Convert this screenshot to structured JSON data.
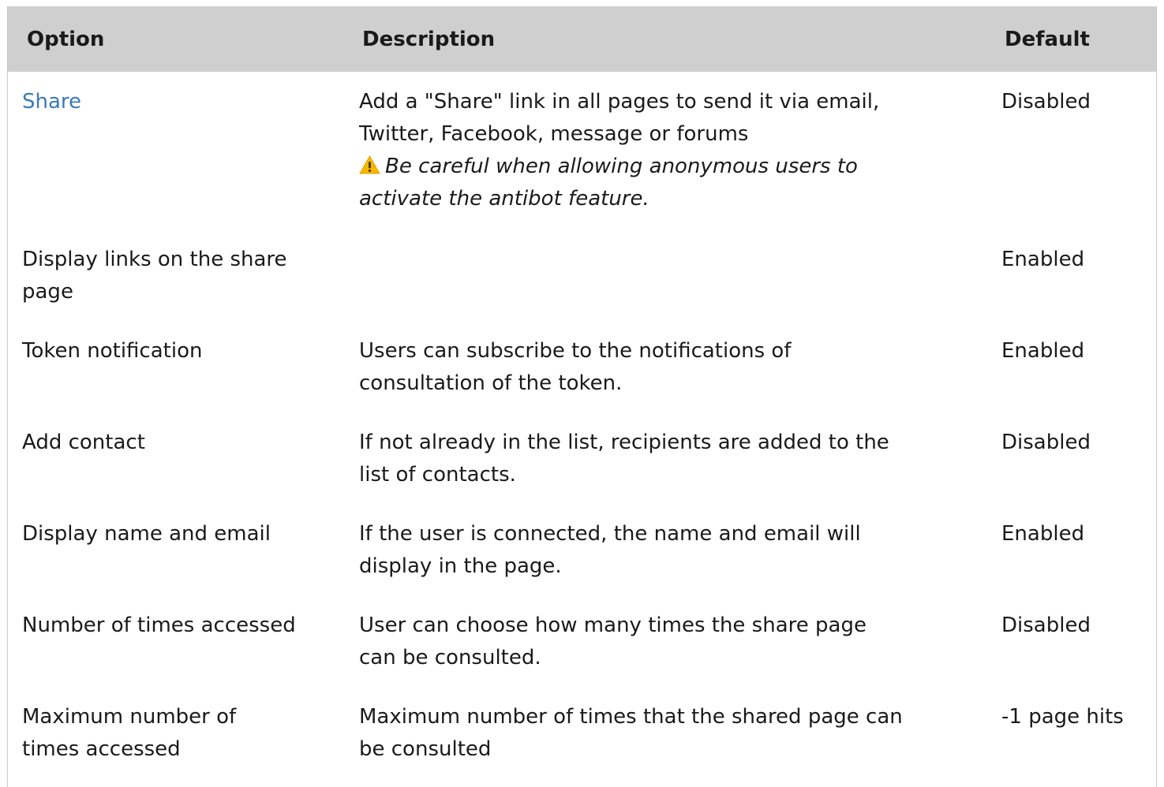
{
  "columns": {
    "option": "Option",
    "description": "Description",
    "default": "Default"
  },
  "rows": [
    {
      "option": "Share",
      "description_line1": "Add a \"Share\" link in all pages to send it via email,",
      "description_line2": "Twitter, Facebook, message or forums",
      "warning_line1": "Be careful when allowing anonymous users to",
      "warning_line2": "activate the antibot feature.",
      "default": "Disabled"
    },
    {
      "option_line1": "Display links on the share",
      "option_line2": "page",
      "description": "",
      "default": "Enabled"
    },
    {
      "option": "Token notification",
      "description_line1": "Users can subscribe to the notifications of",
      "description_line2": "consultation of the token.",
      "default": "Enabled"
    },
    {
      "option": "Add contact",
      "description_line1": "If not already in the list, recipients are added to the",
      "description_line2": "list of contacts.",
      "default": "Disabled"
    },
    {
      "option": "Display name and email",
      "description_line1": "If the user is connected, the name and email will",
      "description_line2": "display in the page.",
      "default": "Enabled"
    },
    {
      "option": "Number of times accessed",
      "description_line1": "User can choose how many times the share page",
      "description_line2": "can be consulted.",
      "default": "Disabled"
    },
    {
      "option_line1": "Maximum number of",
      "option_line2": "times accessed",
      "description_line1": "Maximum number of times that the shared page can",
      "description_line2": "be consulted",
      "default": "-1 page hits"
    }
  ],
  "colors": {
    "header_bg": "#cfcfcf",
    "link": "#3a7ab8",
    "warning_icon": "#f5b800"
  },
  "icons": {
    "warning": "warning-icon"
  }
}
